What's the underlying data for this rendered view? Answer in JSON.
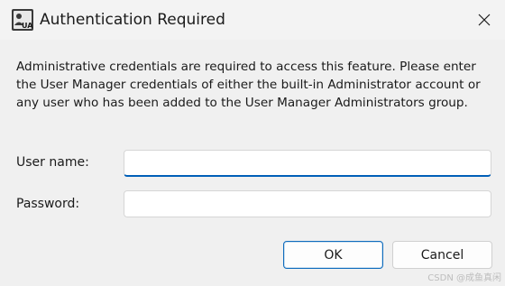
{
  "dialog": {
    "title": "Authentication Required",
    "message": "Administrative credentials are required to access this feature. Please enter the User Manager credentials of either the built-in Administrator account or any user who has been added to the User Manager Administrators group.",
    "app_icon": "user-manager-app-icon",
    "close_icon": "close-icon"
  },
  "form": {
    "username_label": "User name:",
    "username_value": "",
    "password_label": "Password:",
    "password_value": ""
  },
  "buttons": {
    "ok_label": "OK",
    "cancel_label": "Cancel"
  },
  "watermark": "CSDN @成鱼真闲",
  "colors": {
    "accent": "#005fb8",
    "background": "#f0f0f0"
  }
}
